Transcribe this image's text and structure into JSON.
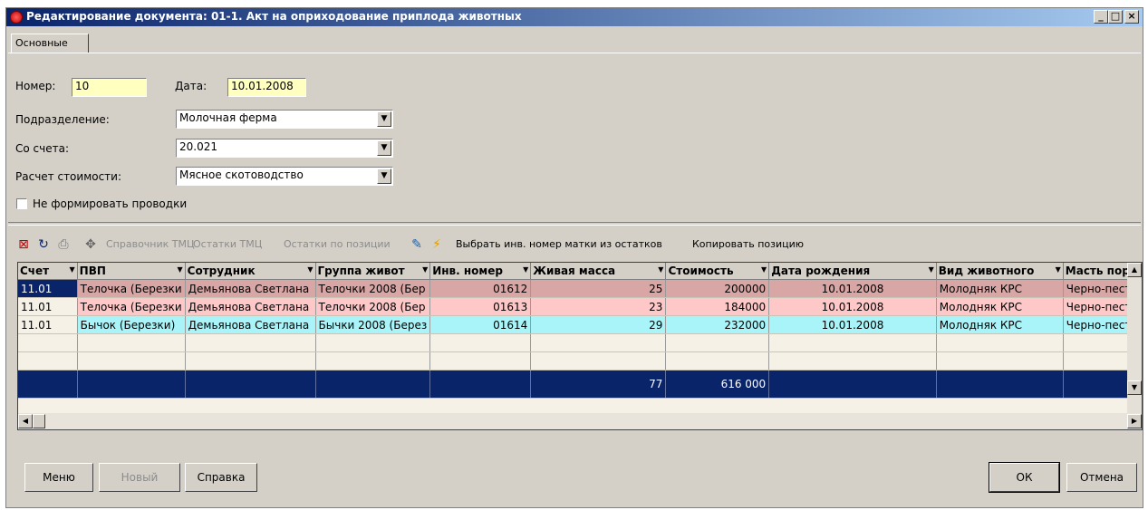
{
  "window": {
    "title": "Редактирование документа: 01-1. Акт на оприходование приплода животных",
    "controls": [
      "_",
      "□",
      "×"
    ]
  },
  "tabs": [
    {
      "label": "Основные"
    }
  ],
  "form": {
    "number_label": "Номер:",
    "number_value": "10",
    "date_label": "Дата:",
    "date_value": "10.01.2008",
    "division_label": "Подразделение:",
    "division_value": "Молочная ферма",
    "account_label": "Со счета:",
    "account_value": "20.021",
    "cost_label": "Расчет стоимости:",
    "cost_value": "Мясное скотоводство",
    "no_postings_label": "Не формировать проводки",
    "no_postings_checked": false
  },
  "toolbar": {
    "icons": [
      "delete-row-icon",
      "refresh-icon",
      "print-icon",
      "move-icon",
      "edit-icon",
      "lightning-icon"
    ],
    "ref_tmc": "Справочник ТМЦ",
    "stock_tmc": "Остатки ТМЦ",
    "stock_by_pos": "Остатки по позиции",
    "select_inv": "Выбрать инв. номер матки из остатков",
    "copy_pos": "Копировать позицию"
  },
  "grid": {
    "columns": [
      "Счет",
      "ПВП",
      "Сотрудник",
      "Группа живот",
      "Инв. номер",
      "Живая масса",
      "Стоимость",
      "Дата рождения",
      "Вид животного",
      "Масть пор"
    ],
    "rows": [
      {
        "schet": "11.01",
        "pvp": "Телочка (Березки",
        "sotr": "Демьянова Светлана",
        "group": "Телочки 2008 (Бер",
        "inv": "01612",
        "mass": "25",
        "cost": "200000",
        "date": "10.01.2008",
        "vid": "Молодняк КРС",
        "mast": "Черно-пестр"
      },
      {
        "schet": "11.01",
        "pvp": "Телочка (Березки",
        "sotr": "Демьянова Светлана",
        "group": "Телочки 2008 (Бер",
        "inv": "01613",
        "mass": "23",
        "cost": "184000",
        "date": "10.01.2008",
        "vid": "Молодняк КРС",
        "mast": "Черно-пестр"
      },
      {
        "schet": "11.01",
        "pvp": "Бычок (Березки)",
        "sotr": "Демьянова Светлана",
        "group": "Бычки 2008 (Берез",
        "inv": "01614",
        "mass": "29",
        "cost": "232000",
        "date": "10.01.2008",
        "vid": "Молодняк КРС",
        "mast": "Черно-пестр"
      }
    ],
    "totals": {
      "mass": "77",
      "cost": "616 000"
    }
  },
  "buttons": {
    "menu": "Меню",
    "new": "Новый",
    "help": "Справка",
    "ok": "ОК",
    "cancel": "Отмена"
  }
}
